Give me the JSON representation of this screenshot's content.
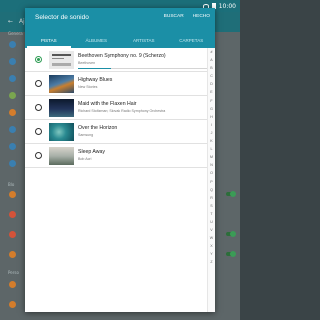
{
  "status_bar": {
    "time": "10:00"
  },
  "background_app": {
    "title": "Ajust",
    "section_headers": [
      "Genera",
      "Blo",
      "Perso"
    ]
  },
  "dialog": {
    "title": "Selector de sonido",
    "actions": {
      "search": "BUSCAR",
      "done": "HECHO"
    },
    "tabs": [
      "PISTAS",
      "ÁLBUMES",
      "ARTISTAS",
      "CARPETAS"
    ],
    "active_tab": "PISTAS",
    "tracks": [
      {
        "title": "Beethoven Symphony no. 9 (Scherzo)",
        "artist": "Beethoven",
        "selected": true,
        "progress": 0.25
      },
      {
        "title": "Highway Blues",
        "artist": "New Stories",
        "selected": false
      },
      {
        "title": "Maid with the Flaxen Hair",
        "artist": "Richard Stoltzman; Slovak Radio Symphony Orchestra",
        "selected": false
      },
      {
        "title": "Over the Horizon",
        "artist": "Samsung",
        "selected": false
      },
      {
        "title": "Sleep Away",
        "artist": "Bob Acri",
        "selected": false
      }
    ],
    "index_letters": [
      "#",
      "A",
      "B",
      "C",
      "D",
      "E",
      "F",
      "G",
      "H",
      "I",
      "J",
      "K",
      "L",
      "M",
      "N",
      "O",
      "P",
      "Q",
      "R",
      "S",
      "T",
      "U",
      "V",
      "W",
      "X",
      "Y",
      "Z"
    ]
  },
  "colors": {
    "accent": "#1b8fa6",
    "radio_selected": "#2e9c54",
    "status_bar": "#1c6f7a"
  }
}
